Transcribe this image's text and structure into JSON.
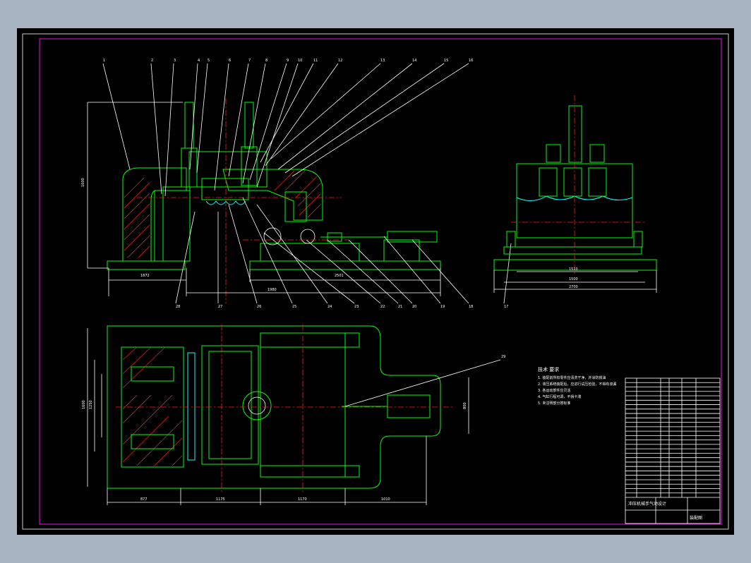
{
  "drawing": {
    "part_numbers_top": [
      "1",
      "2",
      "3",
      "4",
      "5",
      "6",
      "7",
      "8",
      "9",
      "10",
      "11",
      "12",
      "13",
      "14",
      "15",
      "16"
    ],
    "part_numbers_bottom": [
      "28",
      "27",
      "26",
      "25",
      "24",
      "23",
      "22",
      "21",
      "20",
      "19",
      "18",
      "17"
    ],
    "dimensions": {
      "left_width": "1872",
      "front_total": "1980",
      "side_inner": "1510",
      "side_outer": "1500",
      "side_total": "2700",
      "plan_a": "877",
      "plan_b": "1175",
      "plan_c": "1170",
      "plan_d": "1010",
      "cyl_len": "2501",
      "height": "1600",
      "plan_h1": "1600",
      "plan_h2": "1250",
      "plan_h3": "800"
    },
    "plan_callout": "29",
    "notes_title": "技术 要求",
    "notes": [
      "1. 装配前所有零件应清洗干净，并涂防锈油",
      "2. 液压系统装配后，应进行试压检验，不得有渗漏",
      "3. 各运动部件应灵活",
      "4. 气缸行程可调，不得卡滞",
      "5. 未注明部分按标准"
    ],
    "title_block": {
      "title": "冲压机械手气动设计",
      "subtitle": "装配图",
      "rows": 27
    }
  }
}
